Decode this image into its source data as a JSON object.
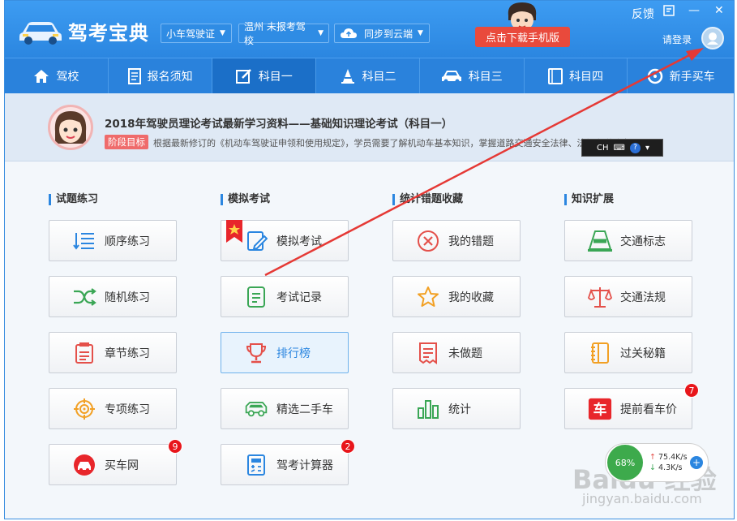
{
  "header": {
    "app_title": "驾考宝典",
    "license_dropdown": "小车驾驶证",
    "school_dropdown": "温州 未报考驾校",
    "sync_button": "同步到云端",
    "download_button": "点击下载手机版",
    "feedback": "反馈",
    "login": "请登录"
  },
  "nav": {
    "tabs": [
      {
        "label": "驾校",
        "icon": "home-icon"
      },
      {
        "label": "报名须知",
        "icon": "document-icon"
      },
      {
        "label": "科目一",
        "icon": "edit-icon",
        "active": true
      },
      {
        "label": "科目二",
        "icon": "cone-icon"
      },
      {
        "label": "科目三",
        "icon": "car-icon"
      },
      {
        "label": "科目四",
        "icon": "book-icon"
      },
      {
        "label": "新手买车",
        "icon": "steering-icon"
      }
    ]
  },
  "banner": {
    "title": "2018年驾驶员理论考试最新学习资料——基础知识理论考试（科目一）",
    "tag": "阶段目标",
    "desc": "根据最新修订的《机动车驾驶证申领和使用规定》，学员需要了解机动车基本知识，掌握道路交通安全法律、法规和道路交通。"
  },
  "ime": {
    "label": "CH"
  },
  "sections": [
    {
      "title": "试题练习"
    },
    {
      "title": "模拟考试"
    },
    {
      "title": "统计错题收藏"
    },
    {
      "title": "知识扩展"
    }
  ],
  "buttons": {
    "col1": [
      {
        "label": "顺序练习",
        "icon": "list-icon"
      },
      {
        "label": "随机练习",
        "icon": "shuffle-icon"
      },
      {
        "label": "章节练习",
        "icon": "chapter-icon"
      },
      {
        "label": "专项练习",
        "icon": "target-icon"
      },
      {
        "label": "买车网",
        "icon": "buy-car-icon",
        "badge": "9"
      }
    ],
    "col2": [
      {
        "label": "模拟考试",
        "icon": "mock-exam-icon"
      },
      {
        "label": "考试记录",
        "icon": "record-icon"
      },
      {
        "label": "排行榜",
        "icon": "trophy-icon"
      },
      {
        "label": "精选二手车",
        "icon": "used-car-icon"
      },
      {
        "label": "驾考计算器",
        "icon": "calculator-icon",
        "badge": "2"
      }
    ],
    "col3": [
      {
        "label": "我的错题",
        "icon": "wrong-icon"
      },
      {
        "label": "我的收藏",
        "icon": "star-icon"
      },
      {
        "label": "未做题",
        "icon": "undone-icon"
      },
      {
        "label": "统计",
        "icon": "stats-icon"
      }
    ],
    "col4": [
      {
        "label": "交通标志",
        "icon": "traffic-sign-icon"
      },
      {
        "label": "交通法规",
        "icon": "scale-icon"
      },
      {
        "label": "过关秘籍",
        "icon": "notebook-icon"
      },
      {
        "label": "提前看车价",
        "icon": "car-price-icon",
        "badge": "7"
      }
    ]
  },
  "net_monitor": {
    "percent": "68%",
    "up": "75.4K/s",
    "down": "4.3K/s"
  },
  "watermark": {
    "text": "Baidu 经验",
    "url": "jingyan.baidu.com"
  },
  "colors": {
    "header": "#2b86e0",
    "active_tab": "#1b6fc8",
    "download": "#e94a3c",
    "badge": "#e8161b"
  }
}
